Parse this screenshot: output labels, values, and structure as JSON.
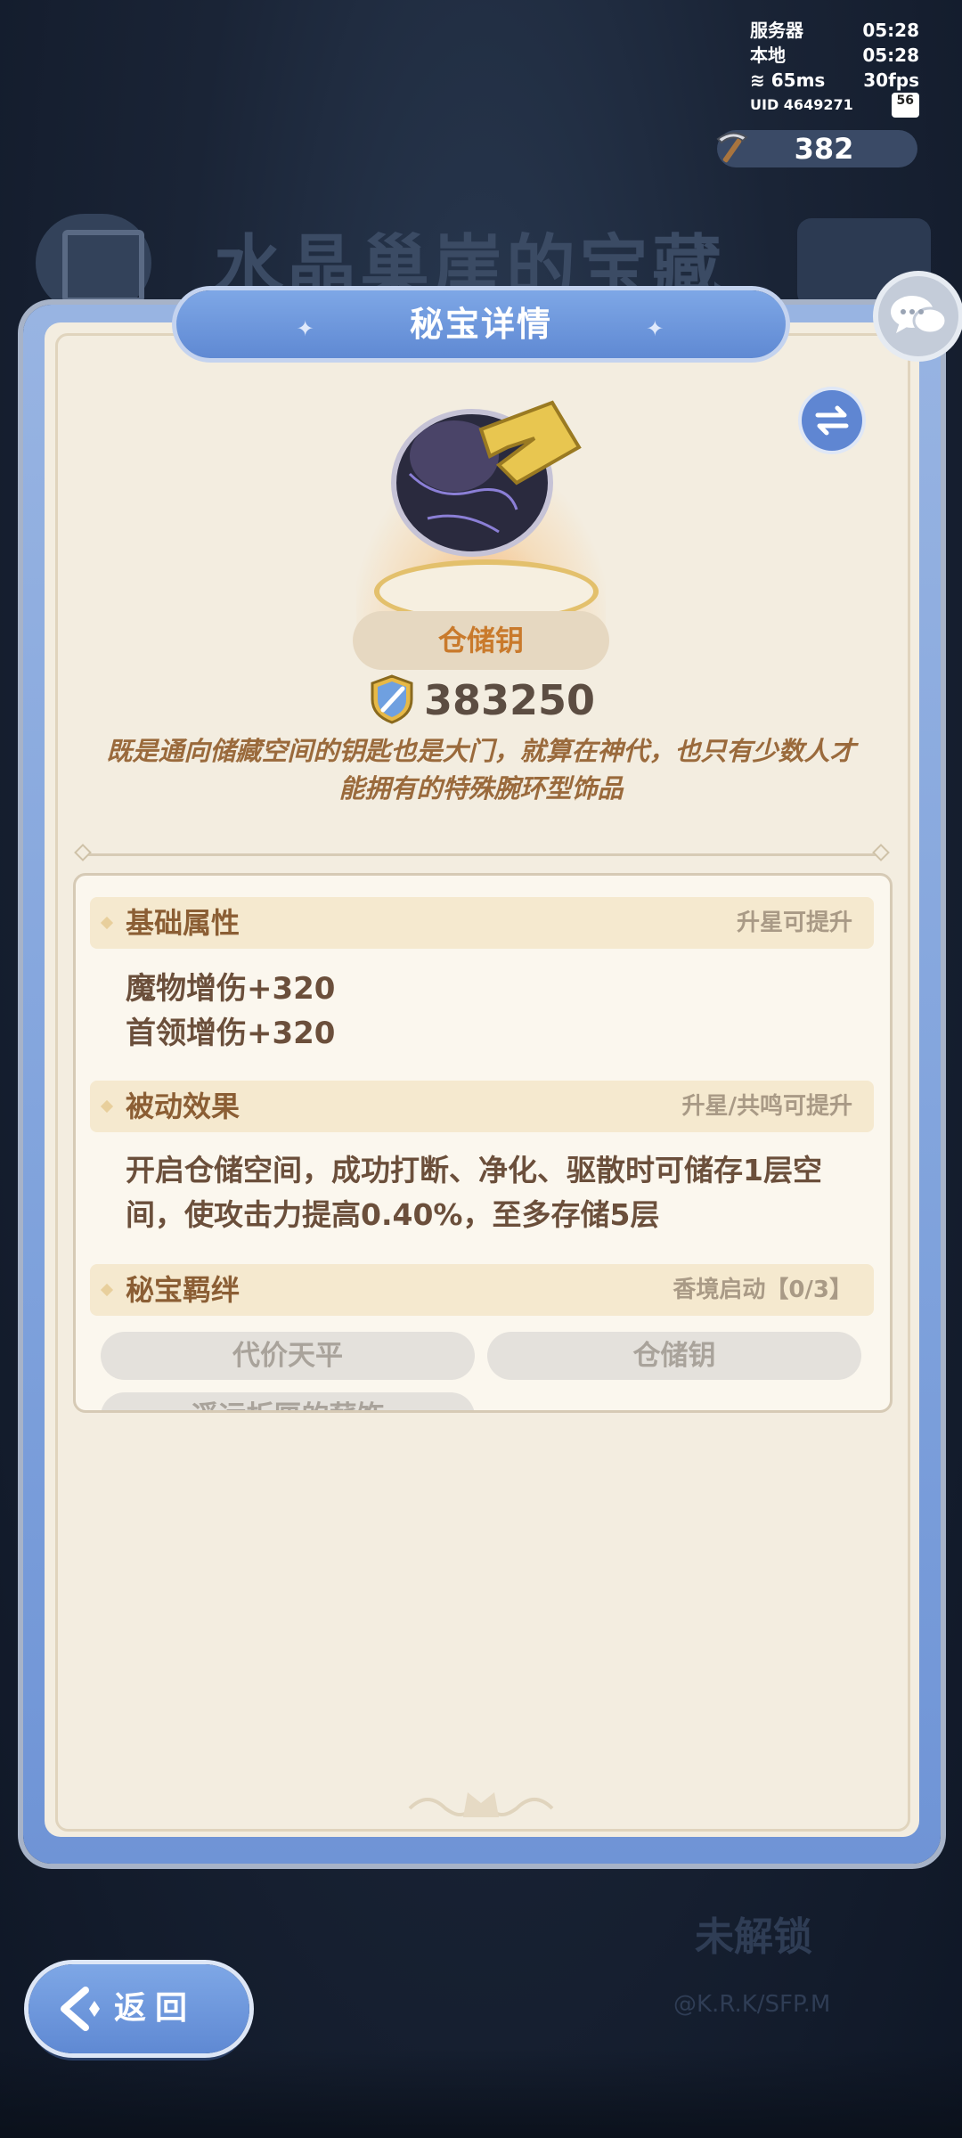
{
  "status": {
    "server_label": "服务器",
    "server_time": "05:28",
    "local_label": "本地",
    "local_time": "05:28",
    "ping": "65ms",
    "fps": "30fps",
    "uid": "UID 4649271",
    "battery": "56"
  },
  "resource": {
    "icon": "pickaxe-icon",
    "value": "382"
  },
  "background": {
    "title": "水晶巢崖的宝藏",
    "locked_text": "未解锁",
    "copyright": "@K.R.K/SFP.M"
  },
  "panel": {
    "title": "秘宝详情",
    "item_name": "仓储钥",
    "score": "383250",
    "description": "既是通向储藏空间的钥匙也是大门，就算在神代，也只有少数人才能拥有的特殊腕环型饰品"
  },
  "sections": {
    "basic": {
      "title": "基础属性",
      "hint": "升星可提升",
      "stats": [
        "魔物增伤+320",
        "首领增伤+320"
      ]
    },
    "passive": {
      "title": "被动效果",
      "hint": "升星/共鸣可提升",
      "text": "开启仓储空间，成功打断、净化、驱散时可储存1层空间，使攻击力提高0.40%，至多存储5层"
    },
    "bond": {
      "title": "秘宝羁绊",
      "hint": "香境启动【0/3】",
      "items": [
        "代价天平",
        "仓储钥",
        "遥远折匣的薪饰"
      ]
    }
  },
  "buttons": {
    "back": "返回"
  },
  "colors": {
    "accent": "#6f94d6",
    "panel_bg": "#f3ede0",
    "label_brown": "#8b5e34"
  }
}
